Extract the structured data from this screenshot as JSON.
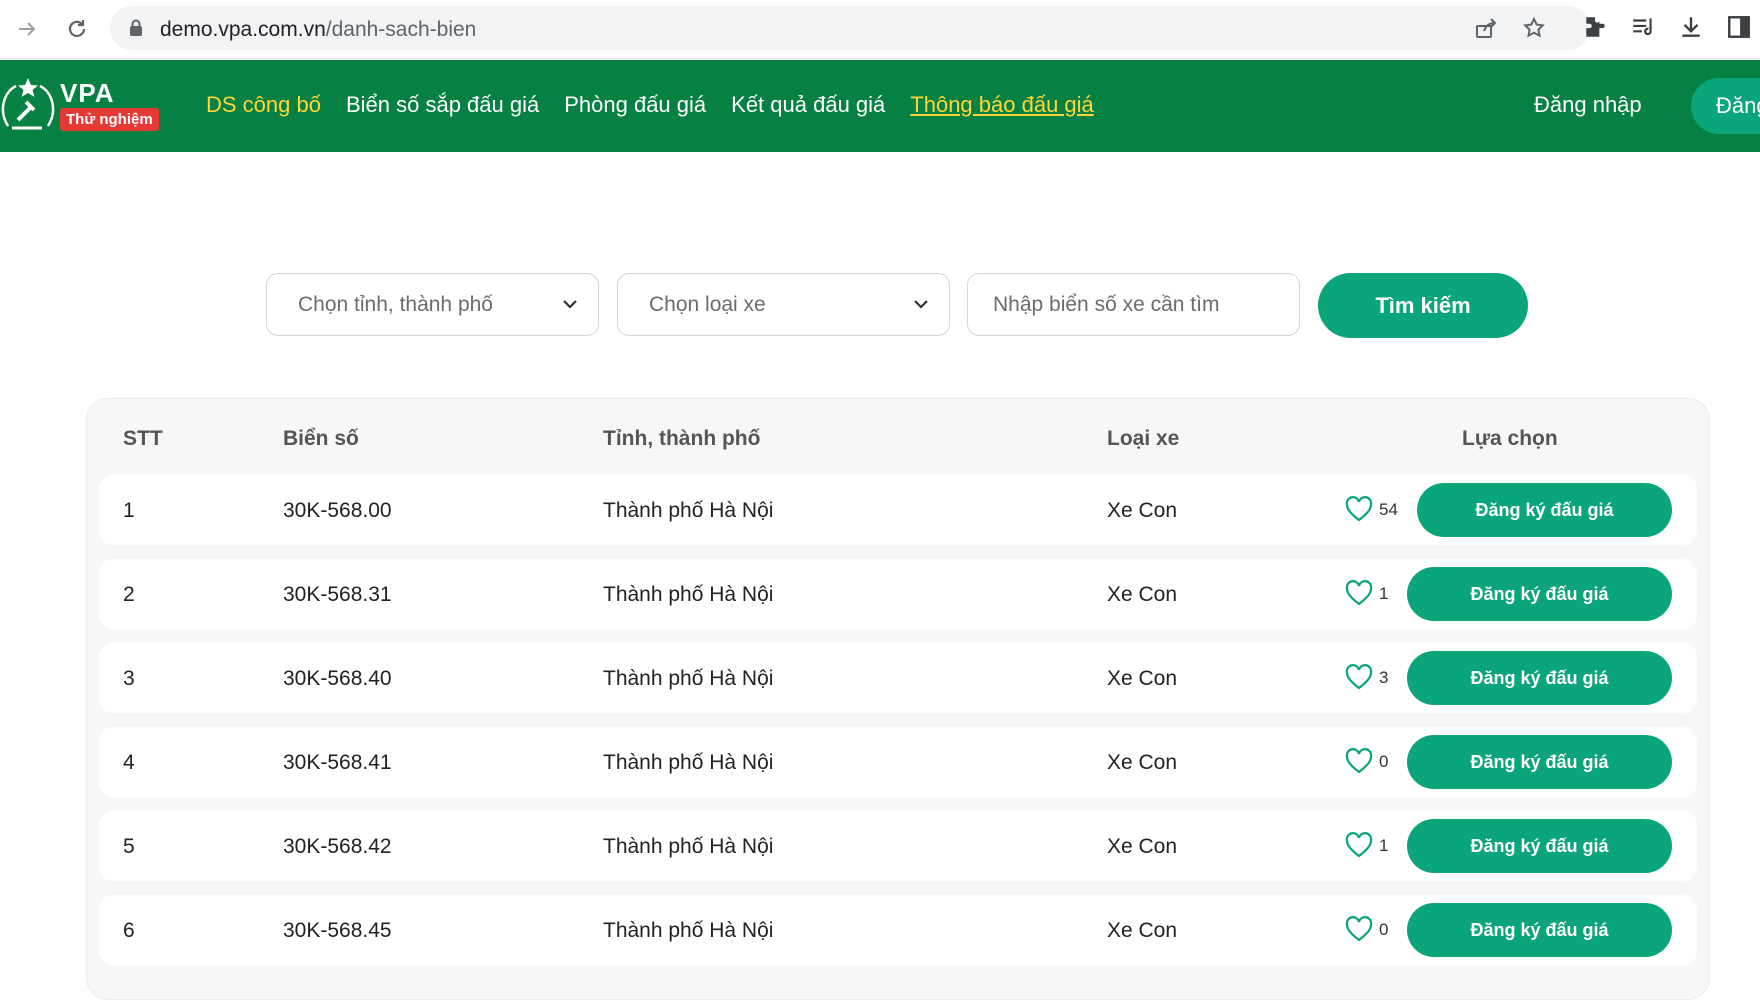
{
  "browser": {
    "url_host": "demo.vpa.com.vn",
    "url_path": "/danh-sach-bien"
  },
  "header": {
    "brand": "VPA",
    "badge": "Thử nghiệm",
    "nav": [
      {
        "label": "DS công bố"
      },
      {
        "label": "Biển số sắp đấu giá"
      },
      {
        "label": "Phòng đấu giá"
      },
      {
        "label": "Kết quả đấu giá"
      },
      {
        "label": "Thông báo đấu giá"
      }
    ],
    "login": "Đăng nhập",
    "register": "Đăng ký"
  },
  "search": {
    "province_placeholder": "Chọn tỉnh, thành phố",
    "vehicle_placeholder": "Chọn loại xe",
    "plate_placeholder": "Nhập biển số xe cần tìm",
    "button": "Tìm kiếm"
  },
  "table": {
    "headers": {
      "stt": "STT",
      "plate": "Biển số",
      "province": "Tỉnh, thành phố",
      "type": "Loại xe",
      "choice": "Lựa chọn"
    },
    "register_label": "Đăng ký đấu giá",
    "rows": [
      {
        "stt": "1",
        "plate": "30K-568.00",
        "province": "Thành phố Hà Nội",
        "type": "Xe Con",
        "likes": "54"
      },
      {
        "stt": "2",
        "plate": "30K-568.31",
        "province": "Thành phố Hà Nội",
        "type": "Xe Con",
        "likes": "1"
      },
      {
        "stt": "3",
        "plate": "30K-568.40",
        "province": "Thành phố Hà Nội",
        "type": "Xe Con",
        "likes": "3"
      },
      {
        "stt": "4",
        "plate": "30K-568.41",
        "province": "Thành phố Hà Nội",
        "type": "Xe Con",
        "likes": "0"
      },
      {
        "stt": "5",
        "plate": "30K-568.42",
        "province": "Thành phố Hà Nội",
        "type": "Xe Con",
        "likes": "1"
      },
      {
        "stt": "6",
        "plate": "30K-568.45",
        "province": "Thành phố Hà Nội",
        "type": "Xe Con",
        "likes": "0"
      }
    ]
  },
  "colors": {
    "header_green": "#068043",
    "accent": "#0aa57a",
    "nav_active": "#ffd633"
  },
  "icons": [
    "forward-icon",
    "reload-icon",
    "lock-icon",
    "share-icon",
    "star-icon",
    "extensions-icon",
    "media-icon",
    "download-icon",
    "sidepanel-icon",
    "chevron-down-icon",
    "heart-icon"
  ]
}
